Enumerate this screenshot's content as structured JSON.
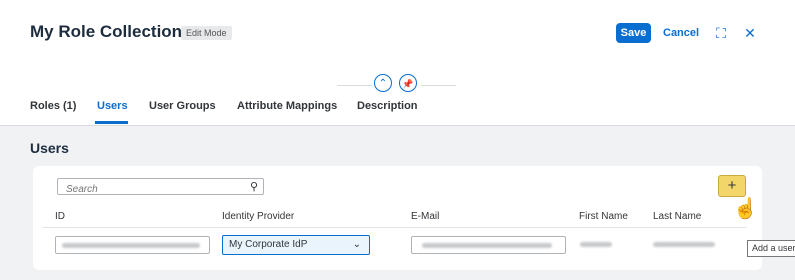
{
  "header": {
    "title": "My Role Collection",
    "mode_badge": "Edit Mode",
    "save_label": "Save",
    "cancel_label": "Cancel",
    "fullscreen_icon": "⛶",
    "close_icon": "✕",
    "collapse_icon": "⌃",
    "pin_icon": "📌"
  },
  "tabs": [
    {
      "label": "Roles (1)"
    },
    {
      "label": "Users"
    },
    {
      "label": "User Groups"
    },
    {
      "label": "Attribute Mappings"
    },
    {
      "label": "Description"
    }
  ],
  "section": {
    "title": "Users"
  },
  "toolbar": {
    "search_placeholder": "Search",
    "search_icon": "⚲",
    "add_icon": "+",
    "add_tooltip": "Add a user"
  },
  "table": {
    "columns": [
      "ID",
      "Identity Provider",
      "E-Mail",
      "First Name",
      "Last Name"
    ],
    "rows": [
      {
        "identity_provider": "My Corporate IdP",
        "chevron": "⌄"
      }
    ]
  },
  "colors": {
    "accent": "#0a6ed1",
    "highlight": "#f3d66a"
  }
}
